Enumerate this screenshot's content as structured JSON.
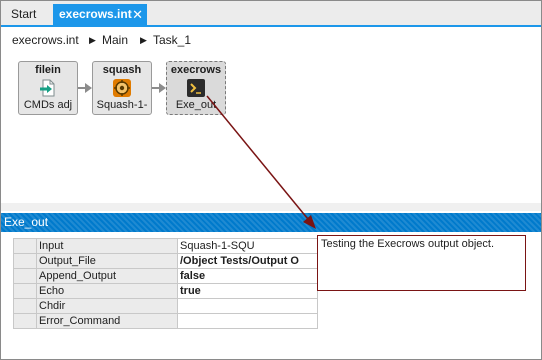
{
  "tabs": [
    {
      "label": "Start"
    },
    {
      "label": "execrows.int",
      "close": "✕"
    }
  ],
  "breadcrumb": [
    "execrows.int",
    "Main",
    "Task_1"
  ],
  "nodes": [
    {
      "title": "filein",
      "label": "CMDs adj",
      "icon": "file-import-icon"
    },
    {
      "title": "squash",
      "label": "Squash-1-",
      "icon": "squash-gear-icon"
    },
    {
      "title": "execrows",
      "label": "Exe_out",
      "icon": "terminal-icon"
    }
  ],
  "panel": {
    "title": "Exe_out",
    "properties": [
      {
        "key": "Input",
        "value": "Squash-1-SQU"
      },
      {
        "key": "Output_File",
        "value": "/Object Tests/Output O"
      },
      {
        "key": "Append_Output",
        "value": "false"
      },
      {
        "key": "Echo",
        "value": "true"
      },
      {
        "key": "Chdir",
        "value": ""
      },
      {
        "key": "Error_Command",
        "value": ""
      }
    ],
    "description": "Testing the Execrows output object."
  },
  "colors": {
    "accent": "#1c97ea",
    "panel_header": "#007acc",
    "annotation": "#7a1414"
  }
}
